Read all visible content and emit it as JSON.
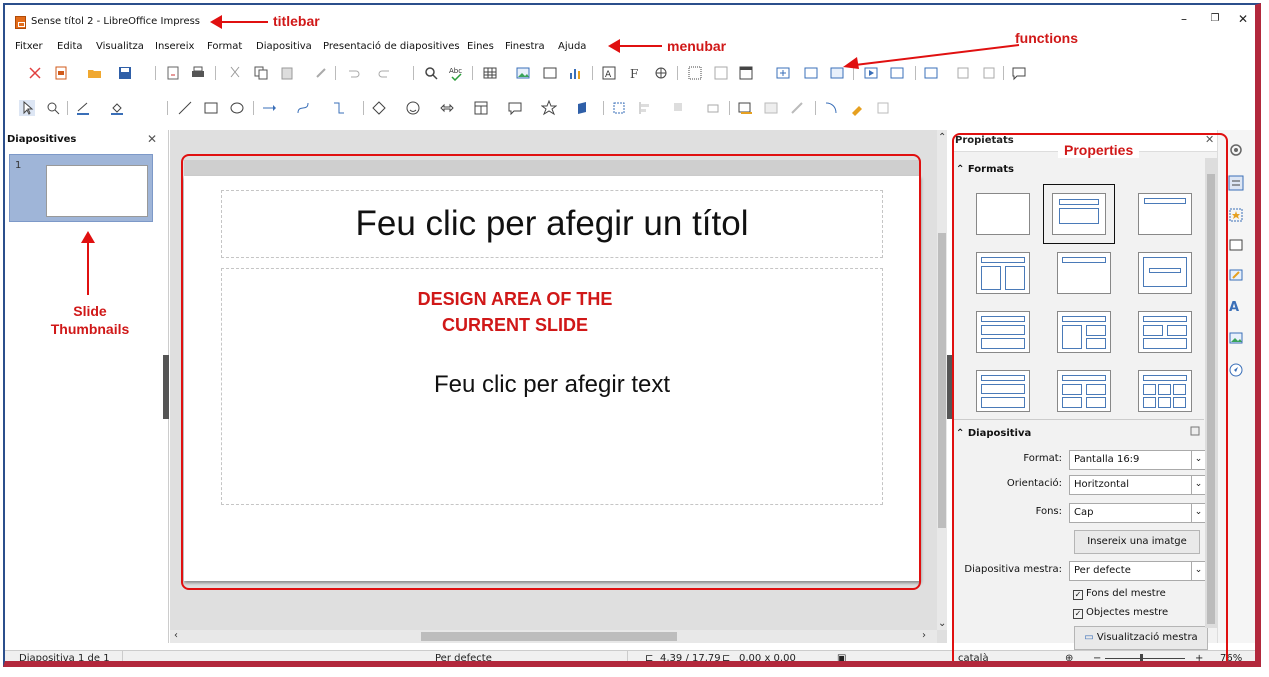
{
  "window": {
    "title": "Sense títol 2 - LibreOffice Impress"
  },
  "menu": [
    "Fitxer",
    "Edita",
    "Visualitza",
    "Insereix",
    "Format",
    "Diapositiva",
    "Presentació de diapositives",
    "Eines",
    "Finestra",
    "Ajuda"
  ],
  "left_pane": {
    "title": "Diapositives",
    "thumbnail_number": "1"
  },
  "slide": {
    "title_placeholder": "Feu clic per afegir un títol",
    "content_placeholder": "Feu clic per afegir text"
  },
  "sidebar": {
    "title": "Propietats",
    "formats_section": "Formats",
    "slide_section": "Diapositiva",
    "format_label": "Format:",
    "format_value": "Pantalla 16:9",
    "orientation_label": "Orientació:",
    "orientation_value": "Horitzontal",
    "background_label": "Fons:",
    "background_value": "Cap",
    "insert_image_button": "Insereix una imatge",
    "master_label": "Diapositiva mestra:",
    "master_value": "Per defecte",
    "master_background_check": "Fons del mestre",
    "master_objects_check": "Objectes mestre",
    "master_view_button": "Visualització mestra"
  },
  "statusbar": {
    "slide_info": "Diapositiva 1 de 1",
    "master": "Per defecte",
    "position": "4,39 / 17,79",
    "size": "0,00 x 0,00",
    "language": "català",
    "zoom": "76%"
  },
  "annotations": {
    "titlebar": "titlebar",
    "menubar": "menubar",
    "functions": "functions",
    "properties": "Properties",
    "thumbnails_line1": "Slide",
    "thumbnails_line2": "Thumbnails",
    "design_line1": "DESIGN AREA OF THE",
    "design_line2": "CURRENT SLIDE"
  },
  "colors": {
    "annotation_red": "#e01010",
    "brand_frame": "#2b4f8c",
    "thumb_selection": "#9fb5d8"
  }
}
